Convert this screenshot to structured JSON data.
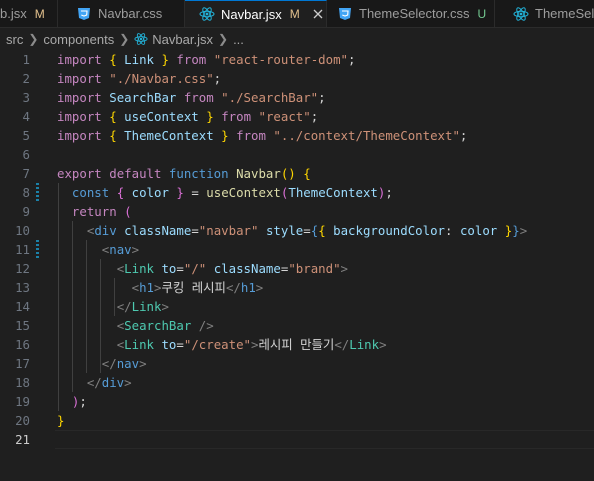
{
  "tabs": [
    {
      "label": "b.jsx",
      "badge": "M",
      "icon": "react-icon",
      "active": false
    },
    {
      "label": "Navbar.css",
      "badge": "",
      "icon": "css-icon",
      "active": false
    },
    {
      "label": "Navbar.jsx",
      "badge": "M",
      "icon": "react-icon",
      "active": true
    },
    {
      "label": "ThemeSelector.css",
      "badge": "U",
      "icon": "css-icon",
      "active": false
    },
    {
      "label": "ThemeSelec",
      "badge": "",
      "icon": "react-icon",
      "active": false
    }
  ],
  "breadcrumb": {
    "folder1": "src",
    "folder2": "components",
    "file": "Navbar.jsx",
    "more": "..."
  },
  "line_numbers": [
    "1",
    "2",
    "3",
    "4",
    "5",
    "6",
    "7",
    "8",
    "9",
    "10",
    "11",
    "12",
    "13",
    "14",
    "15",
    "16",
    "17",
    "18",
    "19",
    "20",
    "21"
  ],
  "current_line": "21",
  "code_lines": [
    "import { Link } from \"react-router-dom\";",
    "import \"./Navbar.css\";",
    "import SearchBar from \"./SearchBar\";",
    "import { useContext } from \"react\";",
    "import { ThemeContext } from \"../context/ThemeContext\";",
    "",
    "export default function Navbar() {",
    "  const { color } = useContext(ThemeContext);",
    "  return (",
    "    <div className=\"navbar\" style={{ backgroundColor: color }}>",
    "      <nav>",
    "        <Link to=\"/\" className=\"brand\">",
    "          <h1>쿠킹 레시피</h1>",
    "        </Link>",
    "        <SearchBar />",
    "        <Link to=\"/create\">레시피 만들기</Link>",
    "      </nav>",
    "    </div>",
    "  );",
    "}",
    ""
  ],
  "colors": {
    "keyword": "#c586c0",
    "storage": "#569cd6",
    "string": "#ce9178",
    "variable": "#9cdcfe",
    "function": "#dcdcaa",
    "component": "#4ec9b0",
    "react_icon": "#23b2d8",
    "css_icon": "#42a5f5",
    "modified": "#e2c08d",
    "untracked": "#73c991"
  }
}
